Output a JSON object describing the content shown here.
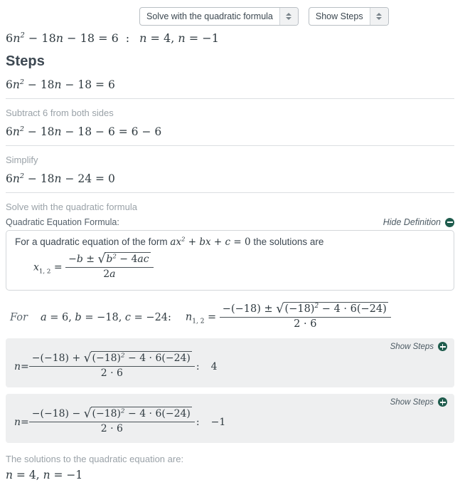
{
  "toolbar": {
    "method_select": {
      "value": "Solve with the quadratic formula",
      "arrows_icon": "updown-spinner-icon"
    },
    "steps_select": {
      "value": "Show Steps",
      "arrows_icon": "updown-spinner-icon"
    }
  },
  "answer": {
    "equation": "6n² − 18n − 18 = 6",
    "separator": ":",
    "solutions": "n = 4, n = −1"
  },
  "steps": {
    "title": "Steps",
    "initial_equation": "6n² − 18n − 18 = 6",
    "items": [
      {
        "label": "Subtract 6 from both sides",
        "expression": "6n² − 18n − 18 − 6 = 6 − 6"
      },
      {
        "label": "Simplify",
        "expression": "6n² − 18n − 24 = 0"
      }
    ],
    "method_label": "Solve with the quadratic formula"
  },
  "definition": {
    "title": "Quadratic Equation Formula:",
    "toggle_label": "Hide Definition",
    "toggle_icon": "minus-circle-icon",
    "body_text_before": "For a quadratic equation of the form",
    "body_form": "ax² + bx + c = 0",
    "body_text_after": "the solutions are",
    "formula": "x₁,₂ = (−b ± √(b² − 4ac)) / (2a)",
    "formula_parts": {
      "lhs_var": "x",
      "lhs_sub": "1, 2",
      "equals": "=",
      "numerator": "−b ± √(b² − 4ac)",
      "denominator": "2a"
    }
  },
  "substitution": {
    "for_word": "For",
    "coefficients": "a = 6, b = −18, c = −24:",
    "a": "6",
    "b": "−18",
    "c": "−24",
    "result_var": "n",
    "result_sub": "1, 2",
    "numerator": "−(−18) ± √((−18)² − 4 · 6(−24))",
    "denominator": "2 · 6"
  },
  "results": [
    {
      "show_steps_label": "Show Steps",
      "show_steps_icon": "plus-circle-icon",
      "variable": "n",
      "sign": "+",
      "numerator": "−(−18) + √((−18)² − 4 · 6(−24))",
      "denominator": "2 · 6",
      "value": "4"
    },
    {
      "show_steps_label": "Show Steps",
      "show_steps_icon": "plus-circle-icon",
      "variable": "n",
      "sign": "−",
      "numerator": "−(−18) − √((−18)² − 4 · 6(−24))",
      "denominator": "2 · 6",
      "value": "−1"
    }
  ],
  "final": {
    "label": "The solutions to the quadratic equation are:",
    "solutions": "n = 4, n = −1"
  },
  "colors": {
    "accent_green": "#1f5c4d",
    "muted_text": "#9aa2a8",
    "box_gray": "#eeeff0",
    "heading": "#3d4852"
  }
}
